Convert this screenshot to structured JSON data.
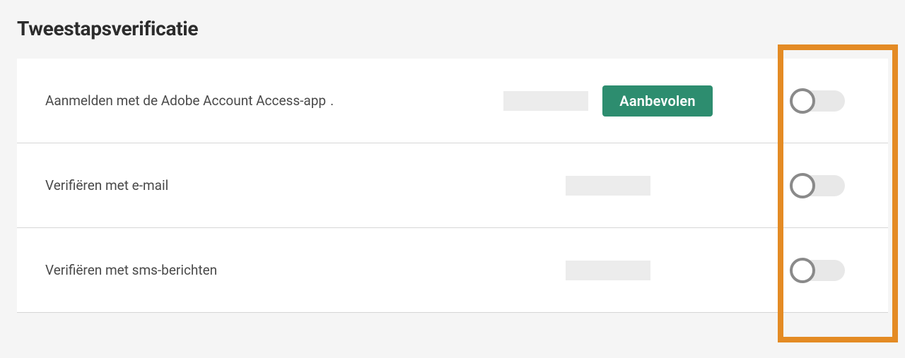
{
  "section": {
    "title": "Tweestapsverificatie"
  },
  "rows": [
    {
      "label": "Aanmelden met de Adobe Account Access-app",
      "badge": "Aanbevolen",
      "toggleState": "off"
    },
    {
      "label": "Verifiëren met e-mail",
      "toggleState": "off"
    },
    {
      "label": "Verifiëren met sms-berichten",
      "toggleState": "off"
    }
  ]
}
